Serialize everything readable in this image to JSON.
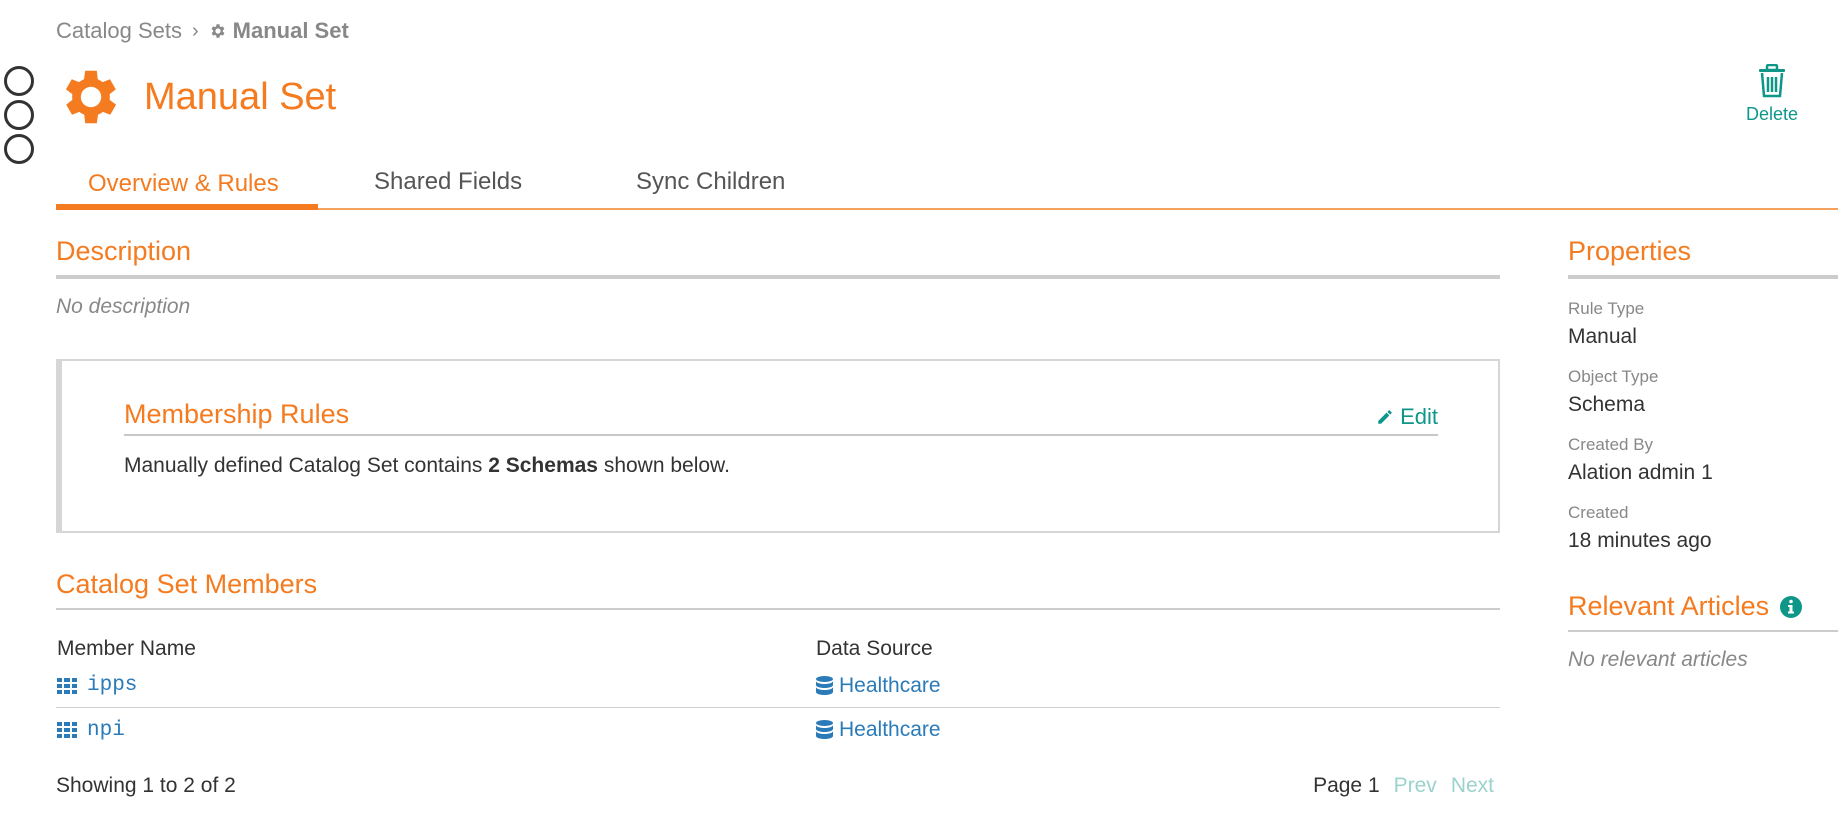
{
  "breadcrumb": {
    "parent": "Catalog Sets",
    "current": "Manual Set"
  },
  "header": {
    "title": "Manual Set",
    "delete_label": "Delete"
  },
  "tabs": [
    {
      "label": "Overview & Rules",
      "active": true
    },
    {
      "label": "Shared Fields",
      "active": false
    },
    {
      "label": "Sync Children",
      "active": false
    }
  ],
  "description": {
    "title": "Description",
    "text": "No description"
  },
  "membership": {
    "title": "Membership Rules",
    "edit_label": "Edit",
    "text_prefix": "Manually defined Catalog Set contains ",
    "text_bold": "2 Schemas",
    "text_suffix": " shown below."
  },
  "members": {
    "title": "Catalog Set Members",
    "columns": [
      "Member Name",
      "Data Source"
    ],
    "rows": [
      {
        "name": "ipps",
        "source": "Healthcare"
      },
      {
        "name": "npi",
        "source": "Healthcare"
      }
    ],
    "showing": "Showing 1 to 2 of 2",
    "page_label": "Page 1",
    "prev_label": "Prev",
    "next_label": "Next"
  },
  "properties": {
    "title": "Properties",
    "items": [
      {
        "label": "Rule Type",
        "value": "Manual"
      },
      {
        "label": "Object Type",
        "value": "Schema"
      },
      {
        "label": "Created By",
        "value": "Alation admin 1"
      },
      {
        "label": "Created",
        "value": "18 minutes ago"
      }
    ]
  },
  "articles": {
    "title": "Relevant Articles",
    "empty_text": "No relevant articles"
  },
  "icons": {
    "gear": "gear-icon",
    "trash": "trash-icon",
    "pencil": "pencil-icon",
    "grid": "grid-icon",
    "database": "database-icon",
    "info": "info-icon"
  },
  "colors": {
    "accent": "#f47b20",
    "teal": "#0e9789",
    "link": "#2b7bb9",
    "status_red": "#b0424a",
    "status_yellow": "#f0bb6a",
    "status_green": "#3a8b45"
  }
}
